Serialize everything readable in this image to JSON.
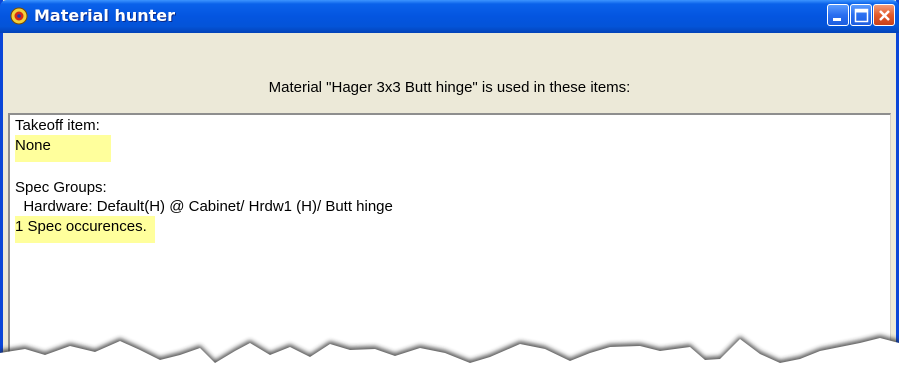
{
  "window": {
    "title": "Material hunter",
    "icon": "app-icon",
    "controls": [
      "minimize-icon",
      "maximize-icon",
      "close-icon"
    ]
  },
  "header": {
    "message": "Material \"Hager 3x3 Butt hinge\" is used in these items:"
  },
  "results": {
    "takeoff_label": "Takeoff item:",
    "takeoff_value": "None",
    "spec_groups_label": "Spec Groups:",
    "spec_groups_entry": "  Hardware: Default(H) @ Cabinet/ Hrdw1 (H)/ Butt hinge",
    "spec_count": "1 Spec occurences."
  },
  "colors": {
    "titlebar": "#0455e0",
    "highlight": "#ffff9c",
    "panel": "#ece9d8"
  }
}
